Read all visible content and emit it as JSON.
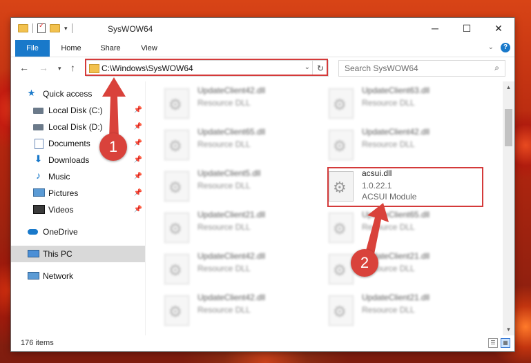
{
  "window": {
    "title": "SysWOW64",
    "buttons": {
      "minimize": "─",
      "maximize": "☐",
      "close": "✕"
    }
  },
  "ribbon": {
    "tabs": [
      "File",
      "Home",
      "Share",
      "View"
    ],
    "help": "?"
  },
  "address": {
    "path": "C:\\Windows\\SysWOW64",
    "search_placeholder": "Search SysWOW64"
  },
  "nav": {
    "items": [
      {
        "label": "Quick access",
        "icon": "star-icon",
        "pinned": false
      },
      {
        "label": "Local Disk (C:)",
        "icon": "disk-icon",
        "pinned": true
      },
      {
        "label": "Local Disk (D:)",
        "icon": "disk-icon",
        "pinned": true
      },
      {
        "label": "Documents",
        "icon": "documents-icon",
        "pinned": true
      },
      {
        "label": "Downloads",
        "icon": "download-icon",
        "pinned": true
      },
      {
        "label": "Music",
        "icon": "music-icon",
        "pinned": true
      },
      {
        "label": "Pictures",
        "icon": "pictures-icon",
        "pinned": true
      },
      {
        "label": "Videos",
        "icon": "videos-icon",
        "pinned": true
      },
      {
        "label": "OneDrive",
        "icon": "cloud-icon",
        "pinned": false
      },
      {
        "label": "This PC",
        "icon": "computer-icon",
        "pinned": false,
        "selected": true
      },
      {
        "label": "Network",
        "icon": "network-icon",
        "pinned": false
      }
    ]
  },
  "files": [
    {
      "name": "UpdateClient42.dll",
      "type": "Resource DLL"
    },
    {
      "name": "UpdateClient63.dll",
      "type": "Resource DLL"
    },
    {
      "name": "UpdateClient65.dll",
      "type": "Resource DLL"
    },
    {
      "name": "UpdateClient42.dll",
      "type": "Resource DLL"
    },
    {
      "name": "UpdateClient5.dll",
      "type": "Resource DLL"
    },
    {
      "name": "acsui.dll",
      "version": "1.0.22.1",
      "type": "ACSUI Module",
      "highlighted": true
    },
    {
      "name": "UpdateClient21.dll",
      "type": "Resource DLL"
    },
    {
      "name": "UpdateClient65.dll",
      "type": "Resource DLL"
    },
    {
      "name": "UpdateClient42.dll",
      "type": "Resource DLL"
    },
    {
      "name": "UpdateClient21.dll",
      "type": "Resource DLL"
    },
    {
      "name": "UpdateClient42.dll",
      "type": "Resource DLL"
    },
    {
      "name": "UpdateClient21.dll",
      "type": "Resource DLL"
    }
  ],
  "status": {
    "item_count": "176 items"
  },
  "annotations": {
    "step1": "1",
    "step2": "2",
    "color": "#d9423b"
  }
}
